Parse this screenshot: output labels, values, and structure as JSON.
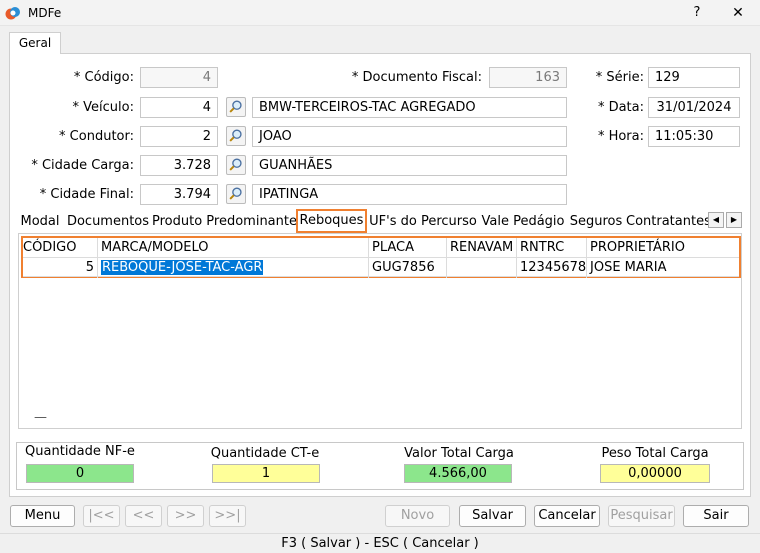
{
  "window": {
    "title": "MDFe",
    "help": "?",
    "close": "✕"
  },
  "outer_tab": "Geral",
  "form": {
    "codigo": {
      "label": "* Código:",
      "value": "4"
    },
    "documento_fiscal": {
      "label": "* Documento Fiscal:",
      "value": "163"
    },
    "serie": {
      "label": "* Série:",
      "value": "129"
    },
    "veiculo": {
      "label": "* Veículo:",
      "code": "4",
      "name": "BMW-TERCEIROS-TAC AGREGADO"
    },
    "data": {
      "label": "* Data:",
      "value": "31/01/2024"
    },
    "condutor": {
      "label": "* Condutor:",
      "code": "2",
      "name": "JOAO"
    },
    "hora": {
      "label": "* Hora:",
      "value": "11:05:30"
    },
    "cidade_carga": {
      "label": "* Cidade Carga:",
      "code": "3.728",
      "name": "GUANHÃES"
    },
    "cidade_final": {
      "label": "* Cidade Final:",
      "code": "3.794",
      "name": "IPATINGA"
    }
  },
  "tabs": [
    "Modal",
    "Documentos",
    "Produto Predominante",
    "Reboques",
    "UF's do Percurso",
    "Vale Pedágio",
    "Seguros",
    "Contratantes"
  ],
  "active_tab": "Reboques",
  "grid": {
    "columns": [
      "CÓDIGO",
      "MARCA/MODELO",
      "PLACA",
      "RENAVAM",
      "RNTRC",
      "PROPRIETÁRIO"
    ],
    "rows": [
      {
        "codigo": "5",
        "marca_modelo": "REBOQUE-JOSE-TAC-AGR",
        "placa": "GUG7856",
        "renavam": "",
        "rntrc": "12345678",
        "proprietario": "JOSE MARIA"
      }
    ],
    "footer_mark": "—"
  },
  "totals": {
    "nfe": {
      "label": "Quantidade NF-e",
      "value": "0",
      "color": "#8ce68c"
    },
    "cte": {
      "label": "Quantidade CT-e",
      "value": "1",
      "color": "#ffff99"
    },
    "valor": {
      "label": "Valor Total Carga",
      "value": "4.566,00",
      "color": "#8ce68c"
    },
    "peso": {
      "label": "Peso Total Carga",
      "value": "0,00000",
      "color": "#ffff99"
    }
  },
  "buttons": {
    "menu": "Menu",
    "first": "|<<",
    "prev": "<<",
    "next": ">>",
    "last": ">>|",
    "novo": "Novo",
    "salvar": "Salvar",
    "cancelar": "Cancelar",
    "pesquisar": "Pesquisar",
    "sair": "Sair"
  },
  "hint": "F3 ( Salvar )  -  ESC ( Cancelar )",
  "colors": {
    "accent": "#f08030",
    "selection": "#0078d7"
  }
}
